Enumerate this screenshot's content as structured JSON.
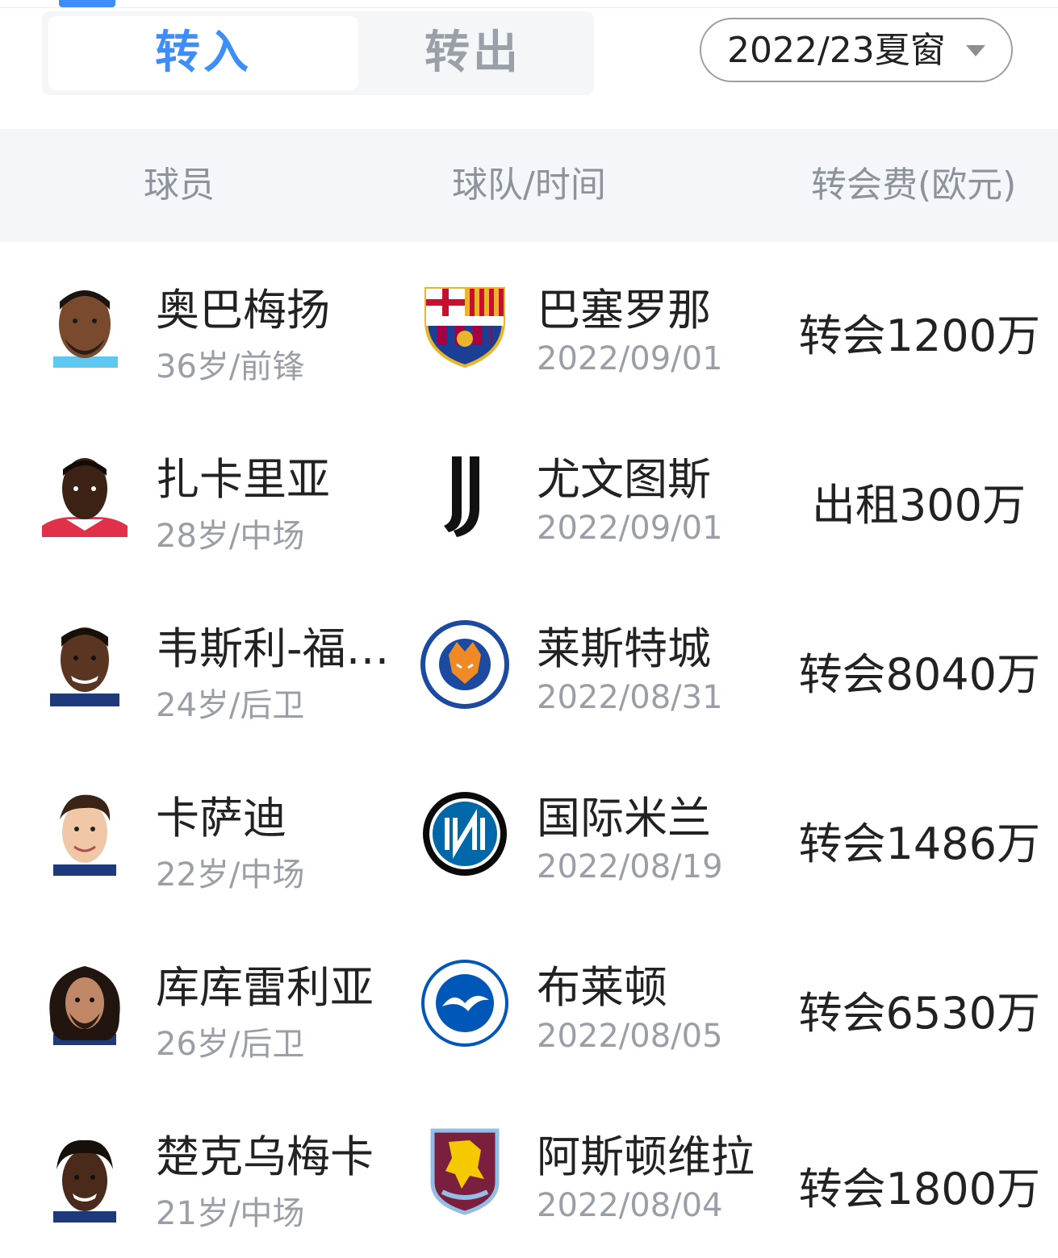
{
  "tabs": {
    "transfer_in": "转入",
    "transfer_out": "转出",
    "active": "transfer_in"
  },
  "season_select": {
    "value": "2022/23夏窗",
    "icon": "caret-down-icon"
  },
  "columns": {
    "player": "球员",
    "team_time": "球队/时间",
    "fee": "转会费(欧元)"
  },
  "colors": {
    "accent": "#3d8ef8",
    "header_bg": "#f4f6f9",
    "muted_text": "#9a9ea6"
  },
  "rows": [
    {
      "name": "奥巴梅扬",
      "meta": "36岁/前锋",
      "club": "巴塞罗那",
      "date": "2022/09/01",
      "fee": "转会1200万",
      "club_icon": "barcelona-crest-icon"
    },
    {
      "name": "扎卡里亚",
      "meta": "28岁/中场",
      "club": "尤文图斯",
      "date": "2022/09/01",
      "fee": "出租300万",
      "club_icon": "juventus-logo-icon"
    },
    {
      "name": "韦斯利-福…",
      "meta": "24岁/后卫",
      "club": "莱斯特城",
      "date": "2022/08/31",
      "fee": "转会8040万",
      "club_icon": "leicester-crest-icon"
    },
    {
      "name": "卡萨迪",
      "meta": "22岁/中场",
      "club": "国际米兰",
      "date": "2022/08/19",
      "fee": "转会1486万",
      "club_icon": "inter-crest-icon"
    },
    {
      "name": "库库雷利亚",
      "meta": "26岁/后卫",
      "club": "布莱顿",
      "date": "2022/08/05",
      "fee": "转会6530万",
      "club_icon": "brighton-crest-icon"
    },
    {
      "name": "楚克乌梅卡",
      "meta": "21岁/中场",
      "club": "阿斯顿维拉",
      "date": "2022/08/04",
      "fee": "转会1800万",
      "club_icon": "aston-villa-crest-icon"
    }
  ]
}
